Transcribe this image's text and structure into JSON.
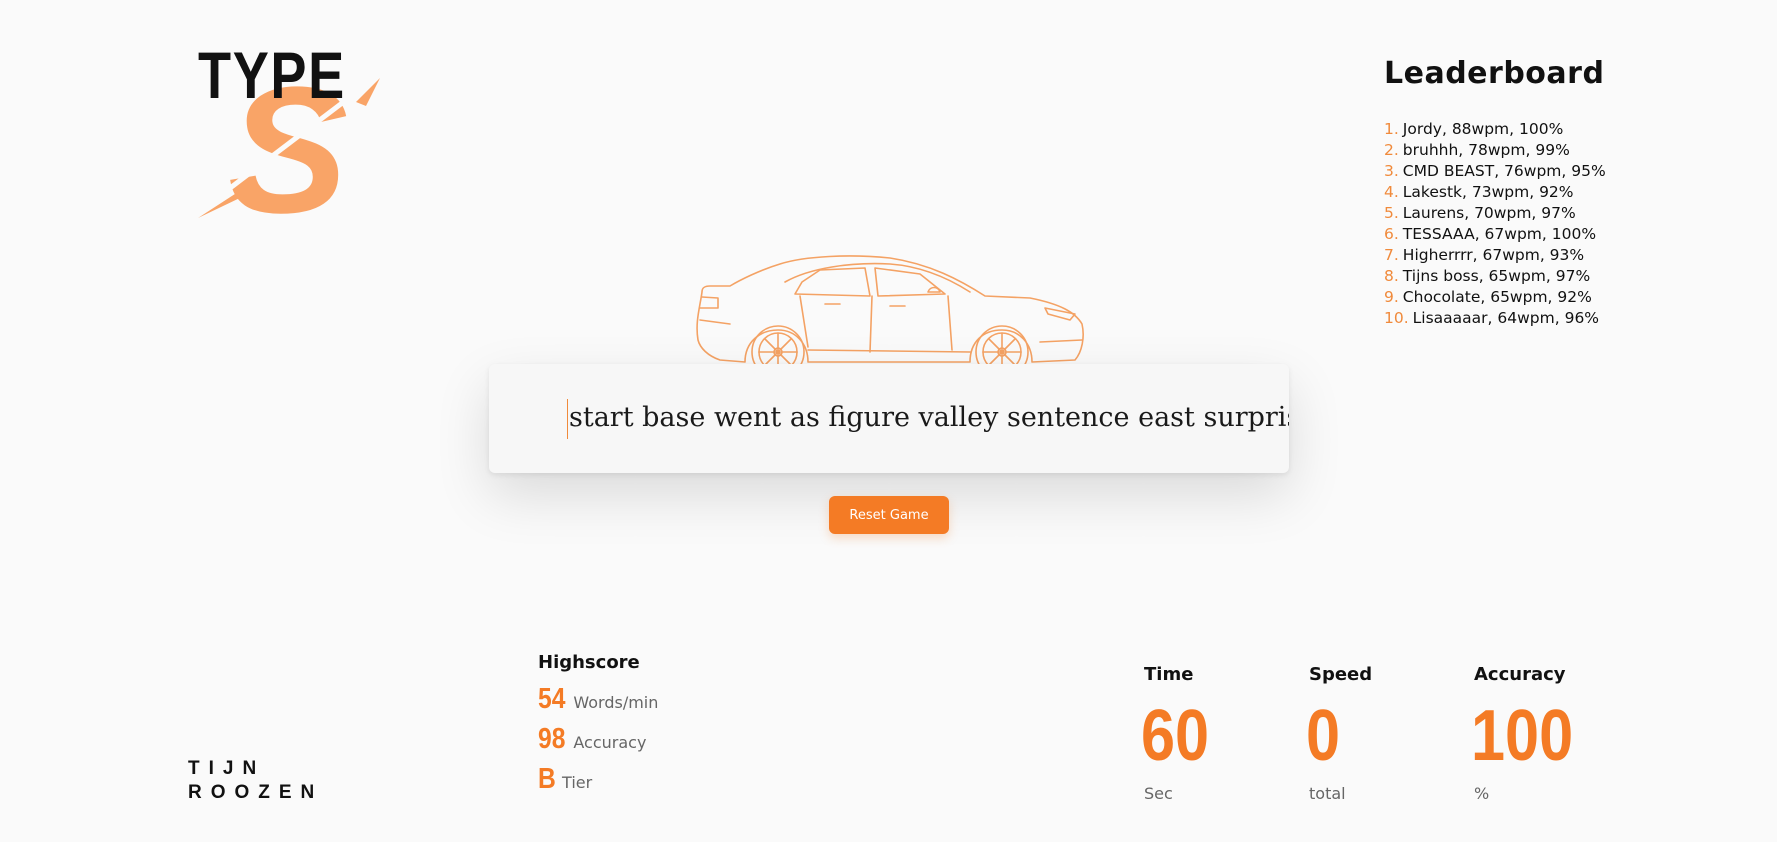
{
  "logo": {
    "text": "TYPE",
    "letter": "S"
  },
  "author": {
    "first": "TIJN",
    "last": "ROOZEN"
  },
  "leaderboard": {
    "title": "Leaderboard",
    "entries": [
      {
        "rank": "1.",
        "text": "Jordy, 88wpm, 100%"
      },
      {
        "rank": "2.",
        "text": "bruhhh, 78wpm, 99%"
      },
      {
        "rank": "3.",
        "text": "CMD BEAST, 76wpm, 95%"
      },
      {
        "rank": "4.",
        "text": "Lakestk, 73wpm, 92%"
      },
      {
        "rank": "5.",
        "text": "Laurens, 70wpm, 97%"
      },
      {
        "rank": "6.",
        "text": "TESSAAA, 67wpm, 100%"
      },
      {
        "rank": "7.",
        "text": "Higherrrr, 67wpm, 93%"
      },
      {
        "rank": "8.",
        "text": "Tijns boss, 65wpm, 97%"
      },
      {
        "rank": "9.",
        "text": "Chocolate, 65wpm, 92%"
      },
      {
        "rank": "10.",
        "text": "Lisaaaaar, 64wpm, 96%"
      }
    ]
  },
  "typing": {
    "text": "start base went as figure valley sentence east surprise language"
  },
  "reset_label": "Reset Game",
  "highscore": {
    "title": "Highscore",
    "wpm_value": "54",
    "wpm_label": "Words/min",
    "accuracy_value": "98",
    "accuracy_label": "Accuracy",
    "tier_value": "B",
    "tier_label": "Tier"
  },
  "stats": {
    "time": {
      "label": "Time",
      "value": "60",
      "unit": "Sec"
    },
    "speed": {
      "label": "Speed",
      "value": "0",
      "unit": "total"
    },
    "accuracy": {
      "label": "Accuracy",
      "value": "100",
      "unit": "%"
    }
  },
  "colors": {
    "accent": "#f47b25",
    "accent_light": "#f9a467",
    "background": "#fafafa"
  },
  "icons": {
    "car": "car-outline-icon"
  }
}
